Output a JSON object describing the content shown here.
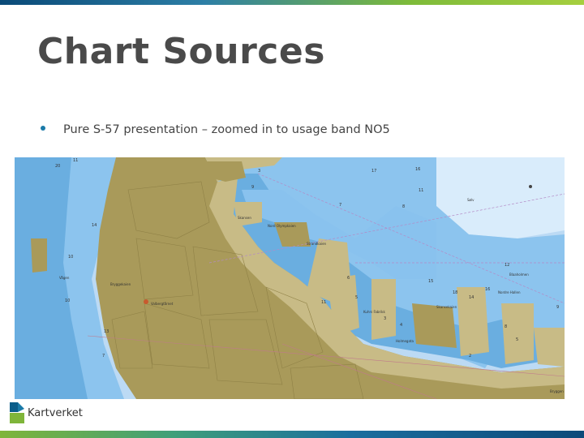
{
  "slide": {
    "title": "Chart Sources",
    "bullet": "Pure S-57 presentation – zoomed in to usage band NO5"
  },
  "map": {
    "place_labels": [
      "Vågen",
      "Bryggekaien",
      "Valbergtårnet",
      "Nord Olympkaien",
      "Skansen",
      "Strandkaien",
      "Kuhrs Fabrikk",
      "Holmegata",
      "Skansekaien",
      "Sølv",
      "Blaaholmen",
      "Nordre Hallen",
      "Bryggen"
    ],
    "depth_soundings": [
      "20",
      "11",
      "14",
      "9",
      "3",
      "17",
      "16",
      "7",
      "11",
      "8",
      "6",
      "5",
      "4",
      "3",
      "10",
      "13",
      "15",
      "12",
      "18",
      "9",
      "16",
      "14",
      "2",
      "8",
      "10",
      "7",
      "5",
      "11"
    ]
  },
  "footer": {
    "logo_text": "Kartverket"
  },
  "colors": {
    "title": "#4a4a4a",
    "bullet": "#1a7aa8",
    "land": "#a99a5a",
    "built_land": "#c8bb86",
    "deep_water": "#b9d8f3",
    "shallow_water": "#6aaee0",
    "mid_water": "#89c2ee"
  }
}
